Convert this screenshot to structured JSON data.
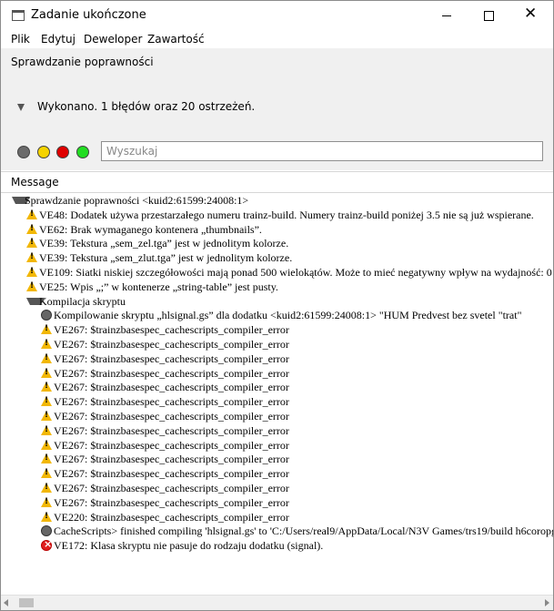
{
  "window": {
    "title": "Zadanie ukończone",
    "close_glyph": "✕"
  },
  "menu": [
    "Plik",
    "Edytuj",
    "Deweloper",
    "Zawartość"
  ],
  "section_label": "Sprawdzanie poprawności",
  "summary": "Wykonano. 1 błędów oraz 20 ostrzeżeń.",
  "filters": [
    {
      "name": "info",
      "color": "#6b6b6b"
    },
    {
      "name": "warning",
      "color": "#f5d300"
    },
    {
      "name": "error",
      "color": "#e00000"
    },
    {
      "name": "success",
      "color": "#22dd22"
    }
  ],
  "search": {
    "placeholder": "Wyszukaj",
    "value": ""
  },
  "column_header": "Message",
  "messages": [
    {
      "level": 0,
      "icon": "expanded-arrow",
      "text": "Sprawdzanie poprawności <kuid2:61599:24008:1>"
    },
    {
      "level": 1,
      "icon": "warning-icon",
      "text": "VE48: Dodatek używa przestarzałego numeru trainz-build. Numery trainz-build poniżej 3.5 nie są już wspierane."
    },
    {
      "level": 1,
      "icon": "warning-icon",
      "text": "VE62: Brak wymaganego kontenera „thumbnails”."
    },
    {
      "level": 1,
      "icon": "warning-icon",
      "text": "VE39: Tekstura „sem_zel.tga” jest w jednolitym kolorze."
    },
    {
      "level": 1,
      "icon": "warning-icon",
      "text": "VE39: Tekstura „sem_zlut.tga” jest w jednolitym kolorze."
    },
    {
      "level": 1,
      "icon": "warning-icon",
      "text": "VE109: Siatki niskiej szczegółowości mają ponad 500 wielokątów. Może to mieć negatywny wpływ na wydajność: 0"
    },
    {
      "level": 1,
      "icon": "warning-icon",
      "text": "VE25: Wpis „;” w kontenerze „string-table” jest pusty."
    },
    {
      "level": 1,
      "icon": "expanded-arrow",
      "text": "Kompilacja skryptu"
    },
    {
      "level": 2,
      "icon": "info-icon",
      "text": "Kompilowanie skryptu „hlsignal.gs” dla dodatku <kuid2:61599:24008:1> \"HUM Predvest bez svetel \"trat\""
    },
    {
      "level": 2,
      "icon": "warning-icon",
      "text": "VE267: $trainzbasespec_cachescripts_compiler_error"
    },
    {
      "level": 2,
      "icon": "warning-icon",
      "text": "VE267: $trainzbasespec_cachescripts_compiler_error"
    },
    {
      "level": 2,
      "icon": "warning-icon",
      "text": "VE267: $trainzbasespec_cachescripts_compiler_error"
    },
    {
      "level": 2,
      "icon": "warning-icon",
      "text": "VE267: $trainzbasespec_cachescripts_compiler_error"
    },
    {
      "level": 2,
      "icon": "warning-icon",
      "text": "VE267: $trainzbasespec_cachescripts_compiler_error"
    },
    {
      "level": 2,
      "icon": "warning-icon",
      "text": "VE267: $trainzbasespec_cachescripts_compiler_error"
    },
    {
      "level": 2,
      "icon": "warning-icon",
      "text": "VE267: $trainzbasespec_cachescripts_compiler_error"
    },
    {
      "level": 2,
      "icon": "warning-icon",
      "text": "VE267: $trainzbasespec_cachescripts_compiler_error"
    },
    {
      "level": 2,
      "icon": "warning-icon",
      "text": "VE267: $trainzbasespec_cachescripts_compiler_error"
    },
    {
      "level": 2,
      "icon": "warning-icon",
      "text": "VE267: $trainzbasespec_cachescripts_compiler_error"
    },
    {
      "level": 2,
      "icon": "warning-icon",
      "text": "VE267: $trainzbasespec_cachescripts_compiler_error"
    },
    {
      "level": 2,
      "icon": "warning-icon",
      "text": "VE267: $trainzbasespec_cachescripts_compiler_error"
    },
    {
      "level": 2,
      "icon": "warning-icon",
      "text": "VE267: $trainzbasespec_cachescripts_compiler_error"
    },
    {
      "level": 2,
      "icon": "warning-icon",
      "text": "VE220: $trainzbasespec_cachescripts_compiler_error"
    },
    {
      "level": 2,
      "icon": "info-icon",
      "text": "CacheScripts> finished compiling 'hlsignal.gs' to 'C:/Users/real9/AppData/Local/N3V Games/trs19/build h6coropg"
    },
    {
      "level": 2,
      "icon": "error-icon",
      "text": "VE172: Klasa skryptu nie pasuje do rodzaju dodatku (signal)."
    }
  ]
}
